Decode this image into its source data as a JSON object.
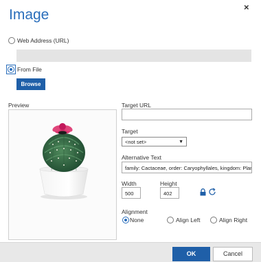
{
  "dialog": {
    "title": "Image",
    "close_symbol": "×"
  },
  "source": {
    "web_address_label": "Web Address (URL)",
    "url_value": "",
    "from_file_label": "From File",
    "selected": "From File",
    "browse_label": "Browse"
  },
  "preview": {
    "label": "Preview",
    "image_subject": "cactus-in-white-pot"
  },
  "target_url": {
    "label": "Target URL",
    "value": ""
  },
  "target": {
    "label": "Target",
    "value": "<not set>"
  },
  "alt_text": {
    "label": "Alternative Text",
    "value": "family: Cactaceae, order: Caryophyllales, kingdom: Plan"
  },
  "size": {
    "width_label": "Width",
    "width_value": "500",
    "height_label": "Height",
    "height_value": "402"
  },
  "alignment": {
    "label": "Alignment",
    "options": [
      "None",
      "Align Left",
      "Align Right"
    ],
    "selected": "None"
  },
  "footer": {
    "ok_label": "OK",
    "cancel_label": "Cancel"
  },
  "colors": {
    "accent": "#2a6ebb",
    "button": "#1f5fa8",
    "footer_bg": "#e8e8e8"
  }
}
